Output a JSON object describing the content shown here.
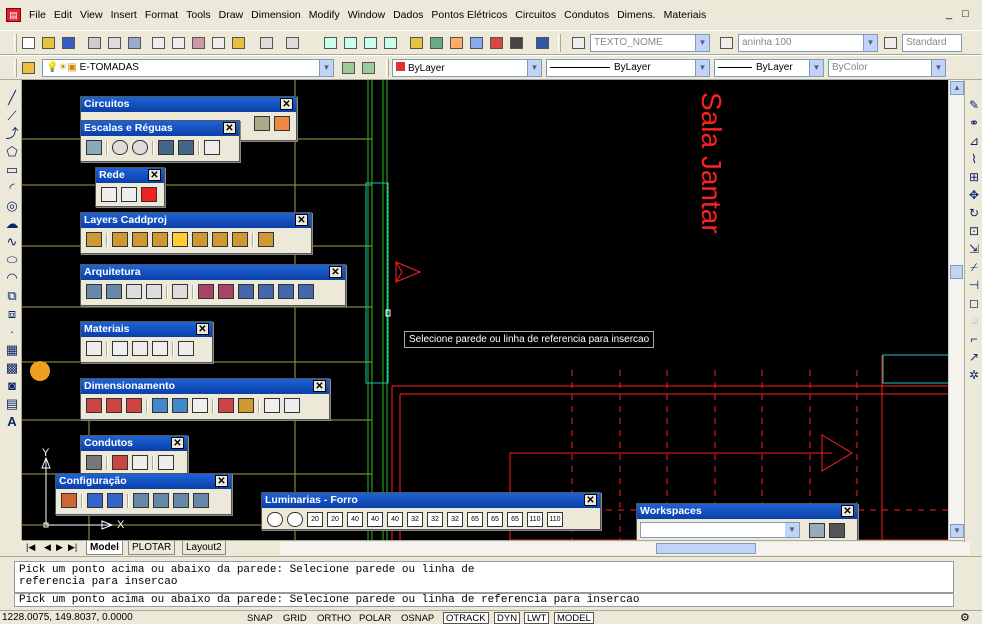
{
  "menu": [
    "File",
    "Edit",
    "View",
    "Insert",
    "Format",
    "Tools",
    "Draw",
    "Dimension",
    "Modify",
    "Window",
    "Dados",
    "Pontos Elétricos",
    "Circuitos",
    "Condutos",
    "Dimens.",
    "Materiais"
  ],
  "window_controls": [
    "_",
    "□"
  ],
  "toolbar1": {
    "textstyle": "TEXTO_NOME",
    "dimstyle": "aninha 100",
    "tablestyle": "Standard"
  },
  "toolbar2": {
    "layer": "E-TOMADAS",
    "color": "ByLayer",
    "linetype": "ByLayer",
    "lineweight": "ByLayer",
    "plotstyle": "ByColor"
  },
  "drawing": {
    "room_label": "Sala Jantar",
    "colors": {
      "background": "#000000",
      "red": "#ff2020",
      "yellow": "#c8c850",
      "green": "#20c020",
      "cyan": "#20c0c0"
    }
  },
  "tooltip": "Selecione parede ou linha de referencia para insercao",
  "panels": {
    "circuitos": "Circuitos",
    "escalas": "Escalas e Réguas",
    "rede": "Rede",
    "layers": "Layers Caddproj",
    "arquitetura": "Arquitetura",
    "materiais": "Materiais",
    "dimensionamento": "Dimensionamento",
    "condutos": "Condutos",
    "configuracao": "Configuração",
    "luminarias": "Luminarias - Forro",
    "luminarias_labels": [
      "20",
      "20",
      "40",
      "40",
      "40",
      "32",
      "32",
      "32",
      "65",
      "65",
      "65",
      "110",
      "110"
    ],
    "workspaces": "Workspaces"
  },
  "tabs": {
    "nav": [
      "|◀",
      "◀",
      "▶",
      "▶|"
    ],
    "items": [
      "Model",
      "PLOTAR",
      "Layout2"
    ]
  },
  "command": {
    "log1": "Pick um ponto acima ou abaixo da parede: Selecione parede ou linha de",
    "log2": "referencia para insercao",
    "current": "Pick um ponto acima ou abaixo da parede: Selecione parede ou linha de referencia para insercao"
  },
  "status": {
    "coords": "1228.0075, 149.8037, 0.0000",
    "buttons": [
      "SNAP",
      "GRID",
      "ORTHO",
      "POLAR",
      "OSNAP",
      "OTRACK",
      "DYN",
      "LWT",
      "MODEL"
    ],
    "on": [
      "OTRACK",
      "DYN",
      "LWT",
      "MODEL"
    ]
  }
}
